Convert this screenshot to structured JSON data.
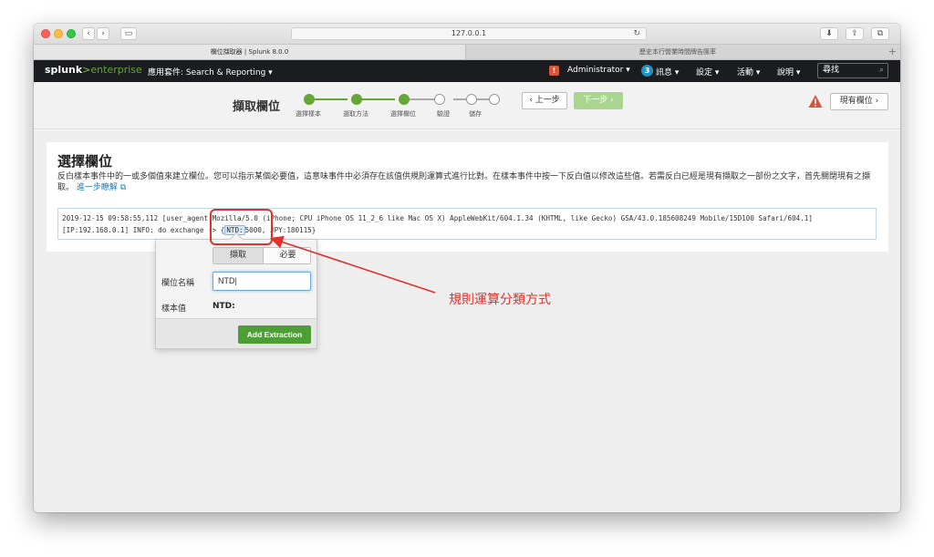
{
  "browser": {
    "url": "127.0.0.1",
    "tabs": [
      {
        "label": "欄位擷取器 | Splunk 8.0.0"
      },
      {
        "label": "歷史本行營業時間牌告匯率"
      }
    ]
  },
  "splunk_bar": {
    "logo_main": "splunk",
    "logo_gt": ">",
    "logo_sub": "enterprise",
    "app_menu": "應用套件: Search & Reporting ▾",
    "alert_count": "!",
    "admin": "Administrator ▾",
    "messages_count": "3",
    "messages": "訊息 ▾",
    "settings": "設定 ▾",
    "activity": "活動 ▾",
    "help": "說明 ▾",
    "find_placeholder": "尋找"
  },
  "wizard": {
    "title": "擷取欄位",
    "steps": [
      {
        "label": "選擇樣本",
        "done": true
      },
      {
        "label": "選取方法",
        "done": true
      },
      {
        "label": "選擇欄位",
        "done": true
      },
      {
        "label": "驗證",
        "done": false
      },
      {
        "label": "儲存",
        "done": false
      }
    ],
    "prev_label": "‹ 上一步",
    "next_label": "下一步 ›",
    "existing_fields": "現有欄位 ›"
  },
  "main": {
    "title": "選擇欄位",
    "description": "反白樣本事件中的一或多個值來建立欄位。您可以指示某個必要值，這意味事件中必須存在該值供規則運算式進行比對。在樣本事件中按一下反白值以修改這些值。若需反白已經是現有擷取之一部份之文字，首先關閉現有之擷取。",
    "learn_more": "進一步瞭解",
    "log_line1": "2019-12-15 09:58:55,112 [user_agent:Mozilla/5.0 (iPhone; CPU iPhone OS 11_2_6 like Mac OS X) AppleWebKit/604.1.34 (KHTML, like Gecko) GSA/43.0.185608249 Mobile/15D100 Safari/604.1]",
    "log_line2_pre": "[IP:192.168.0.1] INFO: do exchange -> {",
    "log_line2_hl": "NTD:",
    "log_line2_post": "5000, JPY:180115}"
  },
  "popover": {
    "tab_extract": "擷取",
    "tab_required": "必要",
    "field_name_label": "欄位名稱",
    "field_name_value": "NTD",
    "sample_value_label": "樣本值",
    "sample_value": "NTD:",
    "add_button": "Add Extraction"
  },
  "annotation": {
    "text": "規則運算分類方式",
    "color": "#e0312b"
  },
  "colors": {
    "splunk_green": "#65a637",
    "accent_blue": "#1e93c6"
  }
}
